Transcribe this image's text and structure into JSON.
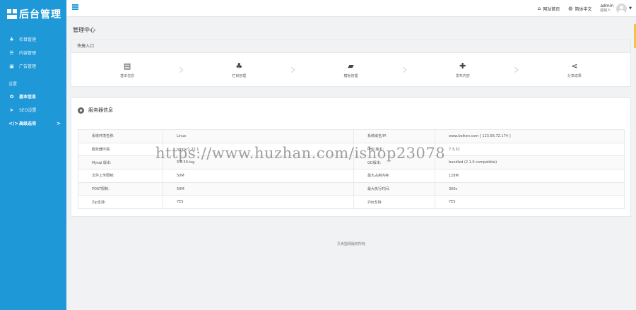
{
  "app": {
    "logo_text": "后台管理"
  },
  "sidebar": {
    "items": [
      {
        "icon": "sitemap-icon",
        "glyph": "♣",
        "label": "栏目管理"
      },
      {
        "icon": "list-icon",
        "glyph": "☰",
        "label": "内容管理"
      },
      {
        "icon": "image-icon",
        "glyph": "▣",
        "label": "广告管理"
      }
    ],
    "section_label": "设置",
    "settings": [
      {
        "icon": "gear-icon",
        "glyph": "✿",
        "label": "基本信息"
      },
      {
        "icon": "send-icon",
        "glyph": "➤",
        "label": "SEO设置"
      },
      {
        "icon": "code-icon",
        "glyph": "</>",
        "label": "高级选项",
        "arrow": ">"
      }
    ]
  },
  "topbar": {
    "home_link": "网站首页",
    "home_icon": "home-icon",
    "lang_link": "简体中文",
    "lang_icon": "globe-icon",
    "user_name": "admin",
    "user_role": "超级人"
  },
  "page": {
    "title": "管理中心"
  },
  "quick": {
    "header": "快捷入口",
    "items": [
      {
        "icon": "newspaper-icon",
        "glyph": "▤",
        "label": "基本信息"
      },
      {
        "icon": "sitemap-icon",
        "glyph": "♣",
        "label": "栏目管理"
      },
      {
        "icon": "folder-open-icon",
        "glyph": "▰",
        "label": "模板管理"
      },
      {
        "icon": "plus-icon",
        "glyph": "✚",
        "label": "发布内容"
      },
      {
        "icon": "share-icon",
        "glyph": "⋖",
        "label": "分享成果"
      }
    ]
  },
  "server": {
    "title": "服务器信息",
    "rows": [
      {
        "k1": "系统环境名称:",
        "v1": "Linux",
        "k2": "系统域名/IP:",
        "v2": "www.beiken.com [ 123.56.72.174 ]"
      },
      {
        "k1": "服务器环境:",
        "v1": "nginx/1.22.1",
        "k2": "PHP 版本:",
        "v2": "7.3.31"
      },
      {
        "k1": "Mysql 版本:",
        "v1": "5.6.50-log",
        "k2": "GD版本:",
        "v2": "bundled (2.1.0 compatible)"
      },
      {
        "k1": "文件上传限制:",
        "v1": "50M",
        "k2": "最大占用内存:",
        "v2": "128M"
      },
      {
        "k1": "POST限制:",
        "v1": "50M",
        "k2": "最大执行时间:",
        "v2": "300s"
      },
      {
        "k1": "Zip支持:",
        "v1": "YES",
        "k2": "Zlib支持:",
        "v2": "YES"
      }
    ]
  },
  "footer": {
    "text": "贝肯盟网版权所有"
  },
  "watermark": {
    "text": "https://www.huzhan.com/ishop23078"
  },
  "colors": {
    "sidebar": "#1f98d7",
    "background": "#f1f2f4",
    "accent_tab": "#f5c24a"
  }
}
